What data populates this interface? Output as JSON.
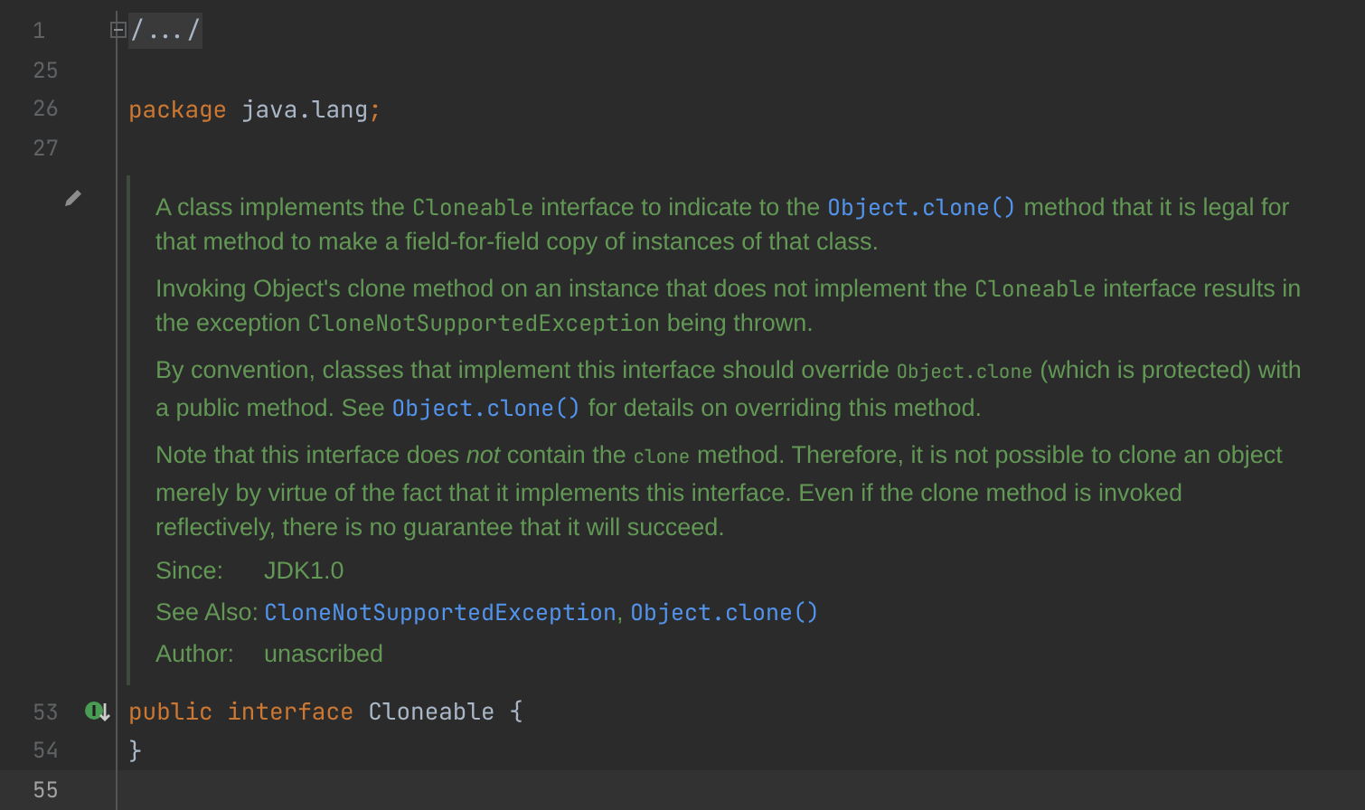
{
  "editor": {
    "lines_before": [
      {
        "number": "1",
        "kind": "fold",
        "text": "/.../"
      },
      {
        "number": "25",
        "kind": "blank"
      },
      {
        "number": "26",
        "kind": "package",
        "keyword": "package",
        "name": "java.lang",
        "end": ";"
      },
      {
        "number": "27",
        "kind": "blank"
      }
    ],
    "doc": {
      "paragraphs": [
        [
          {
            "kind": "text",
            "text": "A class implements the "
          },
          {
            "kind": "code",
            "text": "Cloneable"
          },
          {
            "kind": "text",
            "text": " interface to indicate to the "
          },
          {
            "kind": "link",
            "text": "Object.clone()"
          },
          {
            "kind": "text",
            "text": " method that it is legal for that method to make a field-for-field copy of instances of that class."
          }
        ],
        [
          {
            "kind": "text",
            "text": "Invoking Object's clone method on an instance that does not implement the "
          },
          {
            "kind": "code",
            "text": "Cloneable"
          },
          {
            "kind": "text",
            "text": " interface results in the exception "
          },
          {
            "kind": "code",
            "text": "CloneNotSupportedException"
          },
          {
            "kind": "text",
            "text": " being thrown."
          }
        ],
        [
          {
            "kind": "text",
            "text": "By convention, classes that implement this interface should override "
          },
          {
            "kind": "small_code",
            "text": "Object.clone"
          },
          {
            "kind": "text",
            "text": " (which is protected) with a public method. See "
          },
          {
            "kind": "link",
            "text": "Object.clone()"
          },
          {
            "kind": "text",
            "text": " for details on overriding this method."
          }
        ],
        [
          {
            "kind": "text",
            "text": "Note that this interface does *not* contain the "
          },
          {
            "kind": "small_code",
            "text": "clone"
          },
          {
            "kind": "text",
            "text": " method. Therefore, it is not possible to clone an object merely by virtue of the fact that it implements this interface. Even if the clone method is invoked reflectively, there is no guarantee that it will succeed."
          }
        ]
      ],
      "tags": [
        {
          "label": "Since:",
          "values": [
            {
              "kind": "text",
              "text": "JDK1.0"
            }
          ]
        },
        {
          "label": "See Also:",
          "values": [
            {
              "kind": "link",
              "text": "CloneNotSupportedException"
            },
            {
              "kind": "sep",
              "text": ", "
            },
            {
              "kind": "link",
              "text": "Object.clone()"
            }
          ]
        },
        {
          "label": "Author:",
          "values": [
            {
              "kind": "text",
              "text": "unascribed"
            }
          ]
        }
      ]
    },
    "lines_after": [
      {
        "number": "53",
        "kind": "decl",
        "keywords": "public interface",
        "name": "Cloneable",
        "end": "{",
        "marker": true,
        "current": false
      },
      {
        "number": "54",
        "kind": "close",
        "text": "}",
        "marker": false,
        "current": false
      },
      {
        "number": "55",
        "kind": "blank",
        "marker": false,
        "current": true
      }
    ]
  }
}
